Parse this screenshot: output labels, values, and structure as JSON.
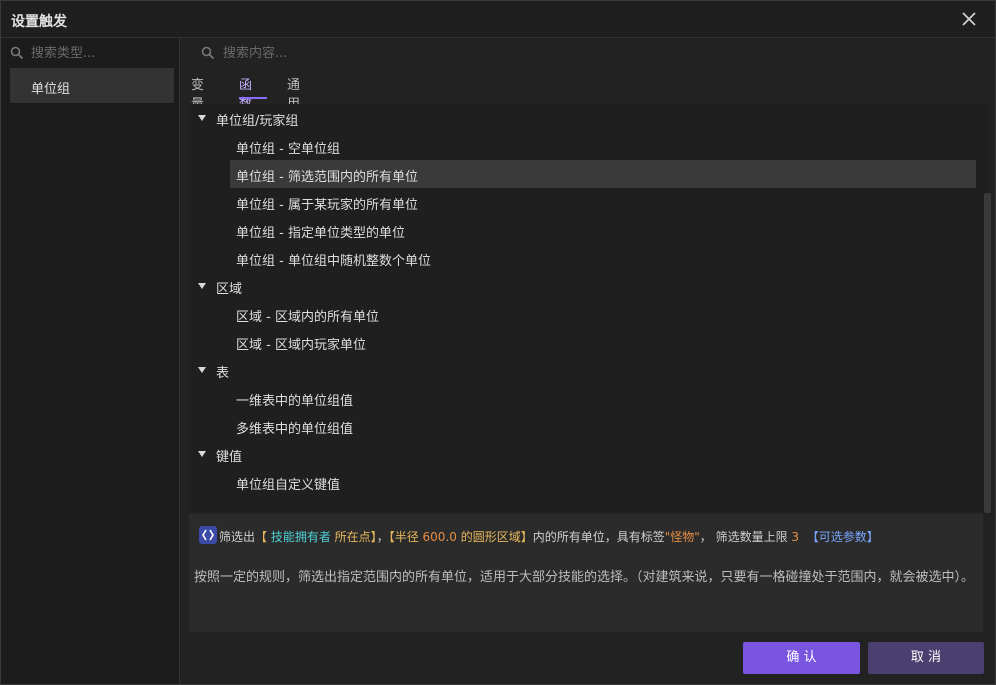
{
  "window": {
    "title": "设置触发"
  },
  "left": {
    "search_placeholder": "搜索类型...",
    "categories": [
      {
        "label": "单位组"
      }
    ]
  },
  "right": {
    "search_placeholder": "搜索内容...",
    "tabs": [
      {
        "label": "变量"
      },
      {
        "label": "函数"
      },
      {
        "label": "通用"
      }
    ],
    "active_tab": "函数",
    "tree": [
      {
        "label": "单位组/玩家组"
      },
      {
        "label": "单位组 - 空单位组"
      },
      {
        "label": "单位组 - 筛选范围内的所有单位"
      },
      {
        "label": "单位组 - 属于某玩家的所有单位"
      },
      {
        "label": "单位组 - 指定单位类型的单位"
      },
      {
        "label": "单位组 - 单位组中随机整数个单位"
      },
      {
        "label": "区域"
      },
      {
        "label": "区域 - 区域内的所有单位"
      },
      {
        "label": "区域 - 区域内玩家单位"
      },
      {
        "label": "表"
      },
      {
        "label": "一维表中的单位组值"
      },
      {
        "label": "多维表中的单位组值"
      },
      {
        "label": "键值"
      },
      {
        "label": "单位组自定义键值"
      }
    ],
    "selected_item": "单位组 - 筛选范围内的所有单位"
  },
  "description": {
    "p1": "筛选出",
    "p2": "【",
    "p3": " 技能拥有者",
    "p4": " 所在点】",
    "p5": "，",
    "p6": "【半径",
    "p7": " 600.0",
    "p8": " 的圆形区域】",
    "p9": "内的所有单位，具有标签",
    "p10": "\"怪物\"",
    "p11": "， 筛选数量上限",
    "p12": " 3",
    "p13": "【可选参数】",
    "body": "按照一定的规则，筛选出指定范围内的所有单位，适用于大部分技能的选择。（对建筑来说，只要有一格碰撞处于范围内，就会被选中）。"
  },
  "buttons": {
    "confirm": "确 认",
    "cancel": "取 消"
  },
  "colors": {
    "accent": "#7a56e0",
    "cancel": "#4a3f6e",
    "highlight_cyan": "#4ed1d6",
    "highlight_yellow": "#e7b85e",
    "highlight_orange": "#e58f45",
    "highlight_blue": "#7aa6ff"
  }
}
